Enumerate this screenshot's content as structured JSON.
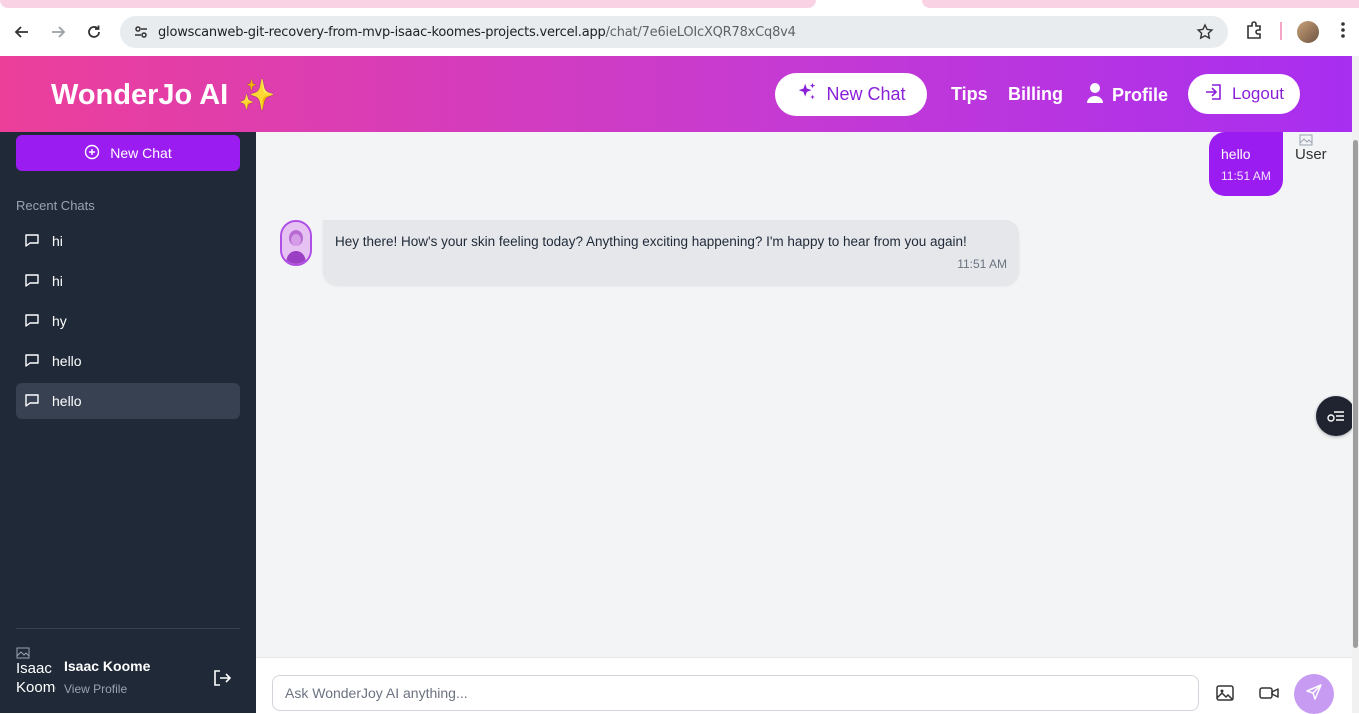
{
  "browser": {
    "url_host": "glowscanweb-git-recovery-from-mvp-isaac-koomes-projects.vercel.app",
    "url_path": "/chat/7e6ieLOIcXQR78xCq8v4"
  },
  "header": {
    "brand": "WonderJo AI",
    "brand_emoji": "✨",
    "new_chat": "New Chat",
    "tips": "Tips",
    "billing": "Billing",
    "profile": "Profile",
    "logout": "Logout",
    "gradient_start": "#ec3f9a",
    "gradient_end": "#a82ef0"
  },
  "sidebar": {
    "new_chat": "New Chat",
    "recent_label": "Recent Chats",
    "items": [
      {
        "label": "hi"
      },
      {
        "label": "hi"
      },
      {
        "label": "hy"
      },
      {
        "label": "hello"
      },
      {
        "label": "hello"
      }
    ],
    "active_index": 4,
    "user": {
      "img_alt": "Isaac Koome",
      "name": "Isaac Koome",
      "view_profile": "View Profile"
    }
  },
  "chat": {
    "messages": [
      {
        "role": "user",
        "text": "hello",
        "time": "11:51 AM",
        "avatar_alt": "User"
      },
      {
        "role": "assistant",
        "text": "Hey there!  How's your skin feeling today?  Anything exciting happening?  I'm happy to hear from you again!",
        "time": "11:51 AM"
      }
    ],
    "input_placeholder": "Ask WonderJoy AI anything..."
  },
  "colors": {
    "accent": "#9b1cf0",
    "sidebar_bg": "#1f2937",
    "chat_bg": "#f3f4f6"
  }
}
